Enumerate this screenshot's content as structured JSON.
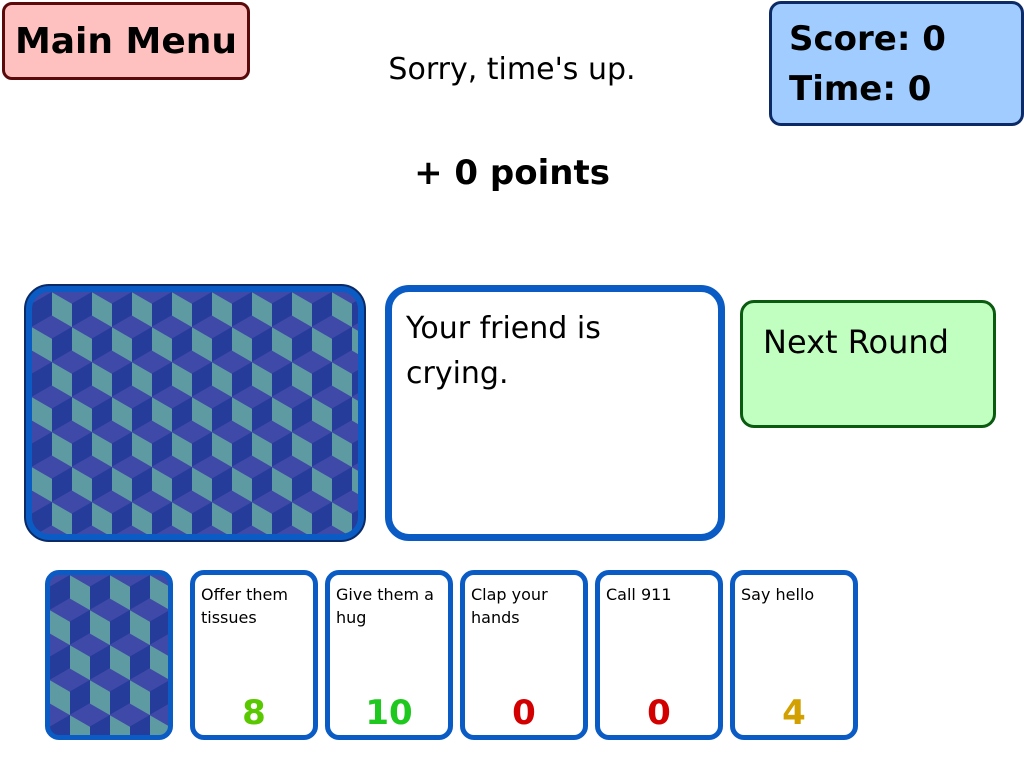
{
  "header": {
    "main_menu_label": "Main Menu",
    "score_label": "Score: 0",
    "time_label": "Time: 0"
  },
  "status": {
    "message": "Sorry, time's up.",
    "points": "+ 0 points"
  },
  "prompt": {
    "text": "Your friend is crying."
  },
  "next_round_label": "Next Round",
  "cards": [
    {
      "text": "Offer them tissues",
      "value": "8",
      "color": "#5ac800"
    },
    {
      "text": "Give them a hug",
      "value": "10",
      "color": "#1ec81e"
    },
    {
      "text": "Clap your hands",
      "value": "0",
      "color": "#d20000"
    },
    {
      "text": "Call 911",
      "value": "0",
      "color": "#d20000"
    },
    {
      "text": "Say hello",
      "value": "4",
      "color": "#d2a000"
    }
  ],
  "colors": {
    "card_border": "#0b5bc4",
    "score_bg": "#a0ccff",
    "menu_bg": "#ffc0c0",
    "next_bg": "#c0ffc0"
  }
}
